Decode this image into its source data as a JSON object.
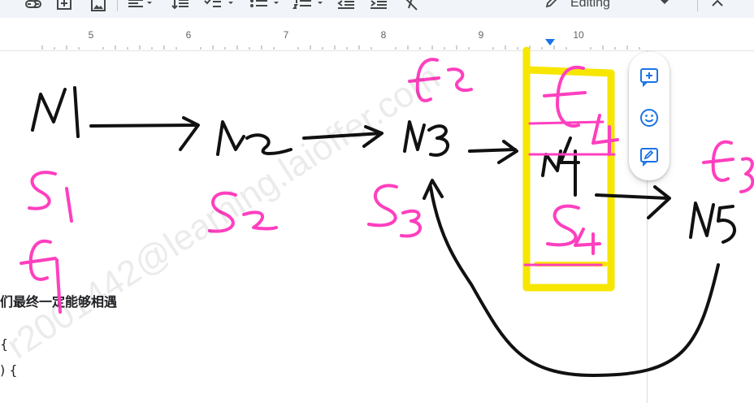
{
  "toolbar": {
    "mode_label": "Editing",
    "icons": [
      "link-icon",
      "add-comment-icon",
      "insert-image-icon",
      "align-icon",
      "line-spacing-icon",
      "checklist-icon",
      "bullet-list-icon",
      "numbered-list-icon",
      "decrease-indent-icon",
      "increase-indent-icon",
      "clear-formatting-icon",
      "edit-pencil-icon",
      "chevron-down-icon",
      "collapse-chevron-icon"
    ]
  },
  "ruler": {
    "numbers": [
      "5",
      "6",
      "7",
      "8",
      "9",
      "10"
    ]
  },
  "handwriting": {
    "nodes": [
      "N1",
      "N2",
      "N3",
      "N4",
      "N5"
    ],
    "black_labels": [
      "S1",
      "S2",
      "S3",
      "S4"
    ],
    "pink_labels": [
      "f2",
      "f4",
      "f3",
      "f1"
    ]
  },
  "document": {
    "line1": "们最终一定能够相遇",
    "line2": "{",
    "line3": ") {"
  },
  "watermark": "r2001442@learning.laioffer.com",
  "side_panel": {
    "buttons": [
      "add-comment-icon",
      "emoji-reaction-icon",
      "suggest-edits-icon"
    ]
  },
  "colors": {
    "ink": "#111111",
    "pink": "#ff3fbf",
    "highlight": "#f7e600",
    "accent": "#1a73e8"
  }
}
